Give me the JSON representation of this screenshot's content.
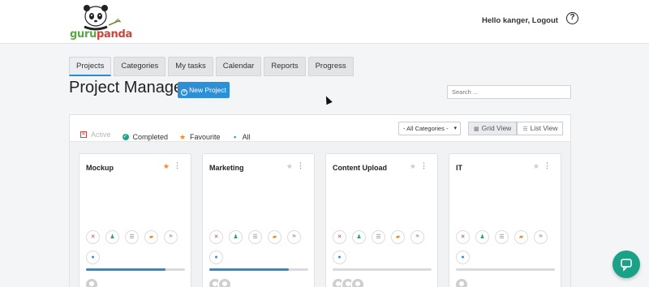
{
  "header": {
    "logo_text_a": "guru",
    "logo_text_b": "panda",
    "greeting": "Hello kanger, Logout",
    "help_symbol": "?"
  },
  "tabs": [
    {
      "label": "Projects",
      "active": true
    },
    {
      "label": "Categories",
      "active": false
    },
    {
      "label": "My tasks",
      "active": false
    },
    {
      "label": "Calendar",
      "active": false
    },
    {
      "label": "Reports",
      "active": false
    },
    {
      "label": "Progress",
      "active": false
    }
  ],
  "page": {
    "title": "Project Manager",
    "new_project_label": "New Project",
    "search_placeholder": "Search ..."
  },
  "filters": [
    {
      "label": "Active",
      "icon": "active-icon",
      "active": true
    },
    {
      "label": "Completed",
      "icon": "check-circle-icon",
      "active": false
    },
    {
      "label": "Favourite",
      "icon": "star-icon",
      "active": false
    },
    {
      "label": "All",
      "icon": "grid-icon",
      "active": false
    }
  ],
  "category_select": {
    "value": "- All Categories -"
  },
  "views": [
    {
      "label": "Grid View",
      "active": true
    },
    {
      "label": "List View",
      "active": false
    }
  ],
  "projects": [
    {
      "title": "Mockup",
      "favourite": true,
      "progress": 0.8,
      "avatars": 1
    },
    {
      "title": "Marketing",
      "favourite": false,
      "progress": 0.8,
      "avatars": 2
    },
    {
      "title": "Content Upload",
      "favourite": false,
      "progress": 0.0,
      "avatars": 3
    },
    {
      "title": "IT",
      "favourite": false,
      "progress": 0.0,
      "avatars": 1
    }
  ],
  "colors": {
    "accent": "#2d8fd5",
    "favourite": "#f08a24",
    "chat": "#19a287",
    "danger": "#d2413a"
  }
}
